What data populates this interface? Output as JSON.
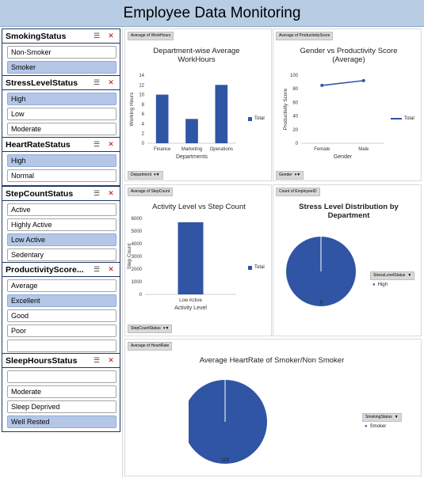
{
  "title": "Employee Data Monitoring",
  "slicers": [
    {
      "title": "SmokingStatus",
      "top": 36,
      "items": [
        {
          "label": "Non-Smoker",
          "selected": false
        },
        {
          "label": "Smoker",
          "selected": true
        }
      ]
    },
    {
      "title": "StressLevelStatus",
      "items": [
        {
          "label": "High",
          "selected": true
        },
        {
          "label": "Low",
          "selected": false
        },
        {
          "label": "Moderate",
          "selected": false
        }
      ]
    },
    {
      "title": "HeartRateStatus",
      "items": [
        {
          "label": "High",
          "selected": true
        },
        {
          "label": "Normal",
          "selected": false
        }
      ]
    },
    {
      "title": "StepCountStatus",
      "items": [
        {
          "label": "Active",
          "selected": false
        },
        {
          "label": "Highly Active",
          "selected": false
        },
        {
          "label": "Low Active",
          "selected": true
        },
        {
          "label": "Sedentary",
          "selected": false
        }
      ]
    },
    {
      "title": "ProductivityScore...",
      "items": [
        {
          "label": "Average",
          "selected": false
        },
        {
          "label": "Excellent",
          "selected": true
        },
        {
          "label": "Good",
          "selected": false
        },
        {
          "label": "Poor",
          "selected": false
        },
        {
          "label": "",
          "selected": false
        }
      ]
    },
    {
      "title": "SleepHoursStatus",
      "items": [
        {
          "label": "",
          "selected": false
        },
        {
          "label": "Moderate",
          "selected": false
        },
        {
          "label": "Sleep Deprived",
          "selected": false
        },
        {
          "label": "Well Rested",
          "selected": true
        }
      ]
    }
  ],
  "icons": {
    "multiselect": "multi-select-icon",
    "clear": "clear-filter-icon"
  },
  "colors": {
    "series": "#2f55a4",
    "selected": "#b4c7e7",
    "title_bar": "#b8cce4"
  },
  "chart_data": [
    {
      "type": "bar",
      "tag": "Average of WorkHours",
      "title": "Department-wise Average WorkHours",
      "xlabel": "Departments",
      "ylabel": "Working Hours",
      "categories": [
        "Finance",
        "Marketing",
        "Operations"
      ],
      "series": [
        {
          "name": "Total",
          "values": [
            10,
            5,
            12
          ]
        }
      ],
      "ylim": [
        0,
        14
      ],
      "yticks": [
        0,
        2,
        4,
        6,
        8,
        10,
        12,
        14
      ],
      "filter_label": "Department"
    },
    {
      "type": "line",
      "tag": "Average of ProductivityScore",
      "title": "Gender vs Productivity Score (Average)",
      "xlabel": "Gender",
      "ylabel": "Productivity Score",
      "categories": [
        "Female",
        "Male"
      ],
      "series": [
        {
          "name": "Total",
          "values": [
            85,
            92
          ]
        }
      ],
      "ylim": [
        0,
        100
      ],
      "yticks": [
        0,
        20,
        40,
        60,
        80,
        100
      ],
      "filter_label": "Gender"
    },
    {
      "type": "bar",
      "tag": "Average of StepCount",
      "title": "Activity Level vs Step Count",
      "xlabel": "Activity Level",
      "ylabel": "Step Count",
      "categories": [
        "Low Active"
      ],
      "series": [
        {
          "name": "Total",
          "values": [
            5700
          ]
        }
      ],
      "ylim": [
        0,
        6000
      ],
      "yticks": [
        0,
        1000,
        2000,
        3000,
        4000,
        5000,
        6000
      ],
      "filter_label": "StepCountStatus"
    },
    {
      "type": "pie",
      "tag": "Count of EmployeeID",
      "title": "Stress Level Distribution by Department",
      "slices": [
        {
          "label": "High",
          "value": 9
        }
      ],
      "data_label": "9",
      "legend_title": "StressLevelStatus",
      "legend": [
        "High"
      ]
    },
    {
      "type": "pie",
      "tag": "Average of HeartRate",
      "title": "Average HeartRate of Smoker/Non Smoker",
      "slices": [
        {
          "label": "Smoker",
          "value": 113
        }
      ],
      "data_label": "113",
      "legend_title": "SmokingStatus",
      "legend": [
        "Smoker"
      ]
    }
  ]
}
